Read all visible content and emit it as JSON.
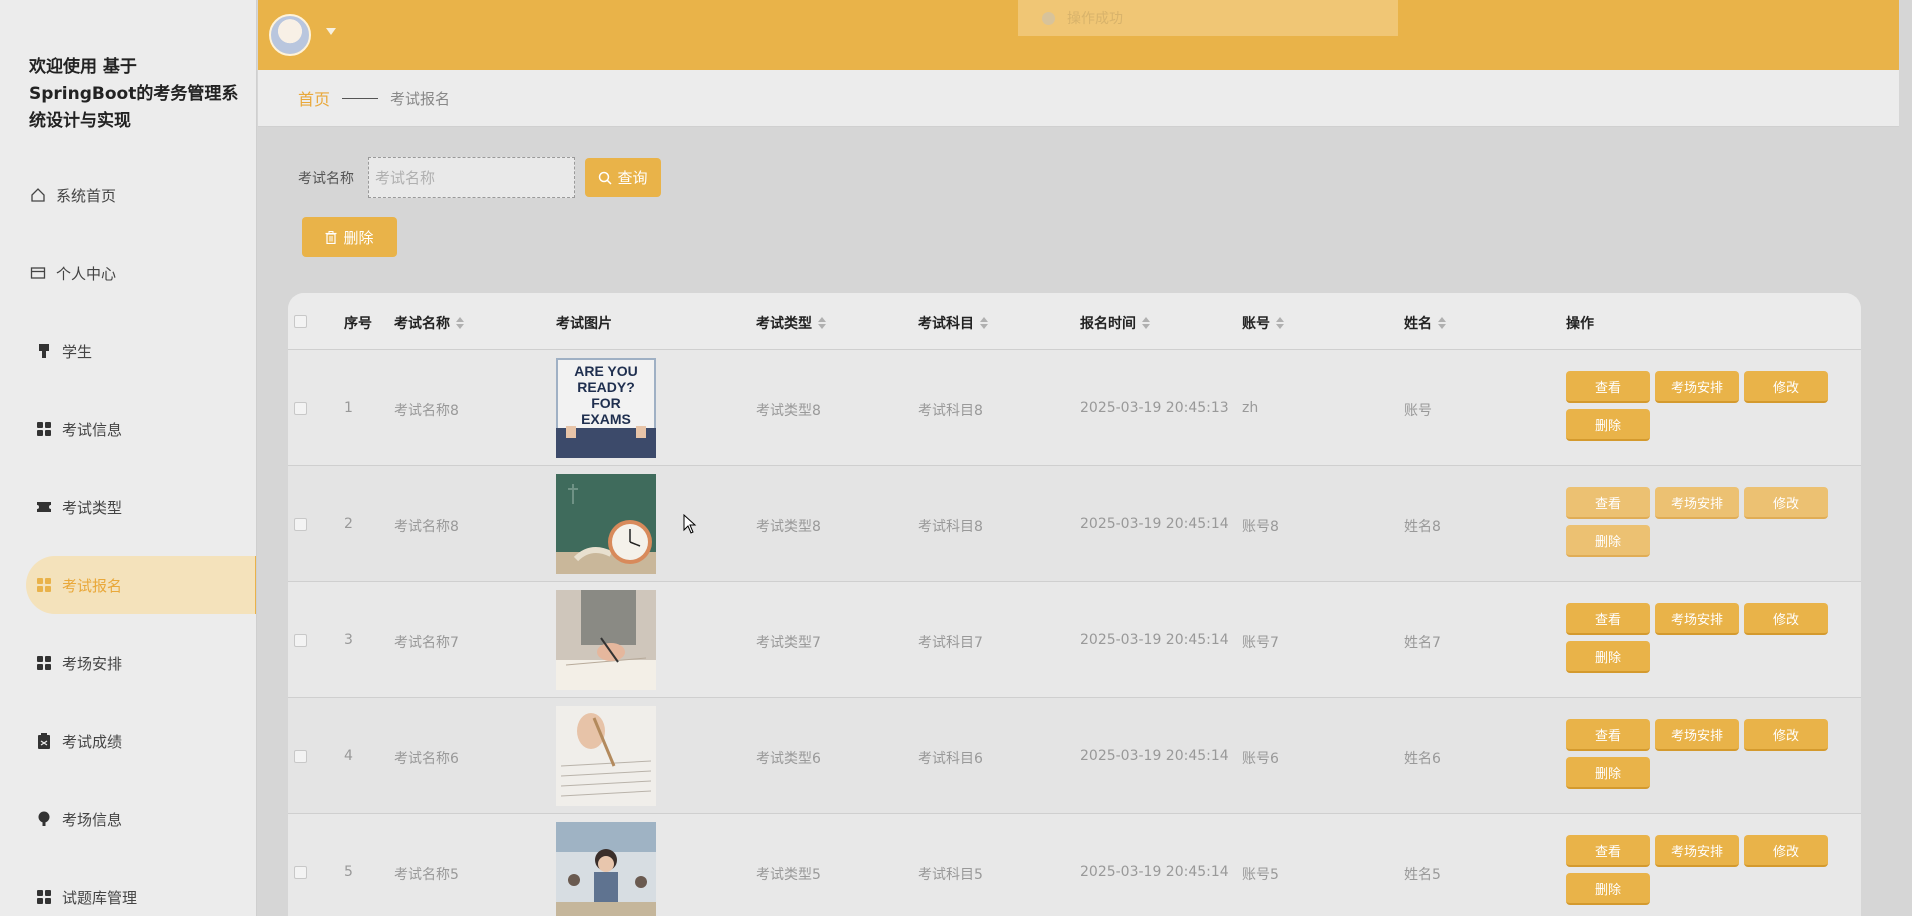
{
  "app": {
    "title": "欢迎使用 基于SpringBoot的考务管理系统设计与实现"
  },
  "sidebar": {
    "items": [
      {
        "label": "系统首页",
        "icon": "home-icon"
      },
      {
        "label": "个人中心",
        "icon": "id-card-icon"
      },
      {
        "label": "学生",
        "icon": "user-icon"
      },
      {
        "label": "考试信息",
        "icon": "grid-icon"
      },
      {
        "label": "考试类型",
        "icon": "ticket-icon"
      },
      {
        "label": "考试报名",
        "icon": "grid-icon",
        "active": true
      },
      {
        "label": "考场安排",
        "icon": "grid-icon"
      },
      {
        "label": "考试成绩",
        "icon": "clipboard-icon"
      },
      {
        "label": "考场信息",
        "icon": "pin-icon"
      },
      {
        "label": "试题库管理",
        "icon": "grid-icon"
      }
    ]
  },
  "toast": {
    "message": "操作成功"
  },
  "breadcrumb": {
    "home": "首页",
    "current": "考试报名"
  },
  "search": {
    "label": "考试名称",
    "placeholder": "考试名称",
    "value": "",
    "query_button": "查询"
  },
  "actions": {
    "batch_delete": "删除"
  },
  "table": {
    "columns": {
      "index": "序号",
      "exam_name": "考试名称",
      "exam_image": "考试图片",
      "exam_type": "考试类型",
      "exam_subject": "考试科目",
      "signup_time": "报名时间",
      "account": "账号",
      "name": "姓名",
      "operations": "操作"
    },
    "op_labels": {
      "view": "查看",
      "arrange": "考场安排",
      "edit": "修改",
      "delete": "删除"
    },
    "rows": [
      {
        "index": "1",
        "exam_name": "考试名称8",
        "image": "are-you-ready-for-exams-sign",
        "image_text": "ARE YOU READY? FOR EXAMS",
        "exam_type": "考试类型8",
        "exam_subject": "考试科目8",
        "signup_time": "2025-03-19 20:45:13",
        "account": "zh",
        "name": "账号"
      },
      {
        "index": "2",
        "exam_name": "考试名称8",
        "image": "clock-chalkboard",
        "exam_type": "考试类型8",
        "exam_subject": "考试科目8",
        "signup_time": "2025-03-19 20:45:14",
        "account": "账号8",
        "name": "姓名8"
      },
      {
        "index": "3",
        "exam_name": "考试名称7",
        "image": "student-writing",
        "exam_type": "考试类型7",
        "exam_subject": "考试科目7",
        "signup_time": "2025-03-19 20:45:14",
        "account": "账号7",
        "name": "姓名7"
      },
      {
        "index": "4",
        "exam_name": "考试名称6",
        "image": "hand-with-pencil",
        "exam_type": "考试类型6",
        "exam_subject": "考试科目6",
        "signup_time": "2025-03-19 20:45:14",
        "account": "账号6",
        "name": "姓名6"
      },
      {
        "index": "5",
        "exam_name": "考试名称5",
        "image": "classroom-exam",
        "exam_type": "考试类型5",
        "exam_subject": "考试科目5",
        "signup_time": "2025-03-19 20:45:14",
        "account": "账号5",
        "name": "姓名5"
      }
    ]
  },
  "colors": {
    "accent": "#e9b349",
    "active_bg": "#f4e2bb",
    "active_text": "#e9a83a"
  }
}
